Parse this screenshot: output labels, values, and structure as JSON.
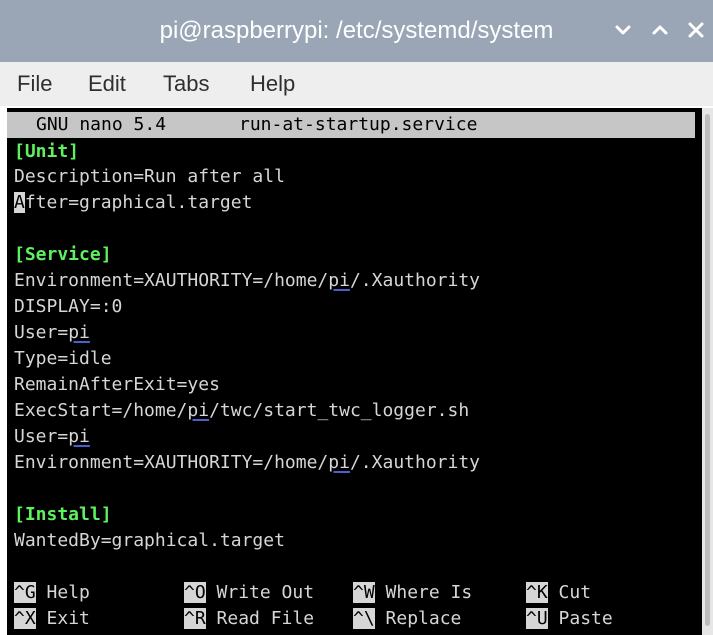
{
  "window": {
    "title": "pi@raspberrypi: /etc/systemd/system"
  },
  "menu": {
    "items": [
      "File",
      "Edit",
      "Tabs",
      "Help"
    ]
  },
  "nano": {
    "version": "GNU nano 5.4",
    "filename": "run-at-startup.service"
  },
  "file_lines": {
    "unit_header": "[Unit]",
    "description": "Description=Run after all",
    "after_cursor_char": "A",
    "after_rest": "fter=graphical.target",
    "service_header": "[Service]",
    "env1_prefix": "Environment=XAUTHORITY=/home/",
    "env1_user": "pi",
    "env1_suffix": "/.Xauthority",
    "display": "DISPLAY=:0",
    "user1_prefix": "User=",
    "user1_value": "pi",
    "type": "Type=idle",
    "remain": "RemainAfterExit=yes",
    "exec_prefix": "ExecStart=/home/",
    "exec_user": "pi",
    "exec_suffix": "/twc/start_twc_logger.sh",
    "user2_prefix": "User=",
    "user2_value": "pi",
    "env2_prefix": "Environment=XAUTHORITY=/home/",
    "env2_user": "pi",
    "env2_suffix": "/.Xauthority",
    "install_header": "[Install]",
    "wantedby": "WantedBy=graphical.target"
  },
  "shortcuts": [
    {
      "key": "^G",
      "label": "Help"
    },
    {
      "key": "^O",
      "label": "Write Out"
    },
    {
      "key": "^W",
      "label": "Where Is"
    },
    {
      "key": "^K",
      "label": "Cut"
    },
    {
      "key": "^X",
      "label": "Exit"
    },
    {
      "key": "^R",
      "label": "Read File"
    },
    {
      "key": "^\\",
      "label": "Replace"
    },
    {
      "key": "^U",
      "label": "Paste"
    }
  ],
  "icons": {
    "minimize": "chevron-down-icon",
    "maximize": "chevron-up-icon",
    "close": "close-icon"
  },
  "colors": {
    "titlebar": "#9aa6b5",
    "menubar": "#eeeeee",
    "terminal_bg": "#000000",
    "terminal_fg": "#d6d6d6",
    "section_green": "#5ff05f",
    "nano_header_bg": "#c6c6c6",
    "underline_blue": "#4a5fd0"
  }
}
